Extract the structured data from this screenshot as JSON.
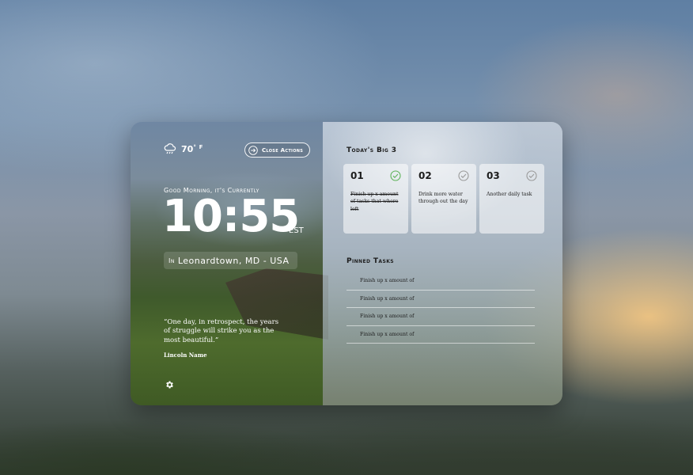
{
  "weather": {
    "icon": "rain-cloud-icon",
    "temperature": "70",
    "degree": "°",
    "unit": "F"
  },
  "close_actions": {
    "icon": "arrow-circle-right-icon",
    "label": "Close Actions"
  },
  "greeting": "Good Morning, it's Currently",
  "clock": {
    "time": "10:55",
    "timezone": "EST"
  },
  "location": {
    "prefix": "In",
    "name": "Leonardtown, MD - USA"
  },
  "quote": {
    "text": "“One day, in retrospect, the years of struggle will strike you as the most beautiful.”",
    "author": "Lincoln Name"
  },
  "settings": {
    "icon": "gear-icon"
  },
  "big3": {
    "title": "Today's Big 3",
    "tasks": [
      {
        "number": "01",
        "text": "Finish up x amount of tasks that where left",
        "done": true,
        "check_color": "#5fb35a"
      },
      {
        "number": "02",
        "text": "Drink more water through out the day",
        "done": false,
        "check_color": "#9a9a9a"
      },
      {
        "number": "03",
        "text": "Another daily task",
        "done": false,
        "check_color": "#9a9a9a"
      }
    ]
  },
  "pinned": {
    "title": "Pinned Tasks",
    "items": [
      "Finish up x amount of",
      "Finish up x amount of",
      "Finish up x amount of",
      "Finish up x amount of"
    ]
  }
}
